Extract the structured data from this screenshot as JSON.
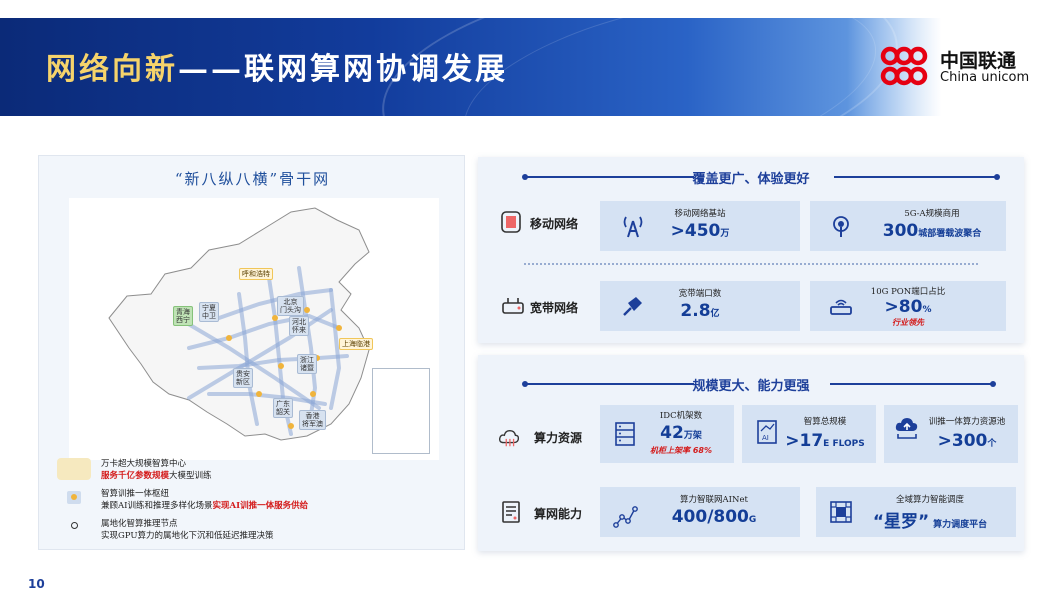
{
  "header": {
    "title_part1": "网络向新",
    "title_part2": "——联网算网协调发展",
    "logo_cn": "中国联通",
    "logo_en": "China unicom"
  },
  "map": {
    "title": "“新八纵八横”骨干网",
    "cities": [
      {
        "label": "呼和浩特",
        "style": "gold"
      },
      {
        "label": "青海\n西宁",
        "style": "green"
      },
      {
        "label": "宁夏\n中卫",
        "style": "blue"
      },
      {
        "label": "北京\n门头沟",
        "style": "blue"
      },
      {
        "label": "河北\n怀来",
        "style": "blue"
      },
      {
        "label": "上海临港",
        "style": "gold"
      },
      {
        "label": "浙江\n诸暨",
        "style": "blue"
      },
      {
        "label": "贵安\n新区",
        "style": "blue"
      },
      {
        "label": "广东\n韶关",
        "style": "blue"
      },
      {
        "label": "香港\n将军澳",
        "style": "blue"
      }
    ],
    "legend": [
      {
        "title": "万卡超大规模智算中心",
        "line_plain": "",
        "line_red": "服务千亿参数规模",
        "line_tail": "大模型训练"
      },
      {
        "title": "智算训推一体枢纽",
        "line_plain": "兼顾AI训练和推理多样化场景",
        "line_red": "实现AI训推一体服务供给",
        "line_tail": ""
      },
      {
        "title": "属地化智算推理节点",
        "line_plain": "实现GPU算力的属地化下沉和低延迟推理决策",
        "line_red": "",
        "line_tail": ""
      }
    ]
  },
  "coverage": {
    "title": "覆盖更广、体验更好",
    "mobile": {
      "label": "移动网络",
      "card1": {
        "caption": "移动网络基站",
        "value": ">450",
        "unit": "万"
      },
      "card2": {
        "caption": "5G-A规模商用",
        "value": "300",
        "unit": "城部署载波聚合"
      }
    },
    "broadband": {
      "label": "宽带网络",
      "card1": {
        "caption": "宽带端口数",
        "value": "2.8",
        "unit": "亿"
      },
      "card2": {
        "caption": "10G PON端口占比",
        "value": ">80",
        "unit": "%",
        "note": "行业领先"
      }
    }
  },
  "compute": {
    "title": "规模更大、能力更强",
    "resources": {
      "label": "算力资源",
      "card1": {
        "caption": "IDC机架数",
        "value": "42",
        "unit": "万架",
        "note": "机柜上架率 68%"
      },
      "card2": {
        "caption": "智算总规模",
        "value": ">17",
        "unit": "E FLOPS"
      },
      "card3": {
        "caption": "训推一体算力资源池",
        "value": ">300",
        "unit": "个"
      }
    },
    "network": {
      "label": "算网能力",
      "card1": {
        "caption": "算力智联网AINet",
        "value": "400/800",
        "unit": "G"
      },
      "card2": {
        "caption": "全域算力智能调度",
        "value": "“星罗”",
        "unit": "算力调度平台"
      }
    }
  },
  "page_number": "10",
  "colors": {
    "accent": "#1d3f9a",
    "gold": "#f6d36b",
    "red": "#d41c1c",
    "card": "#d5e2f3"
  }
}
